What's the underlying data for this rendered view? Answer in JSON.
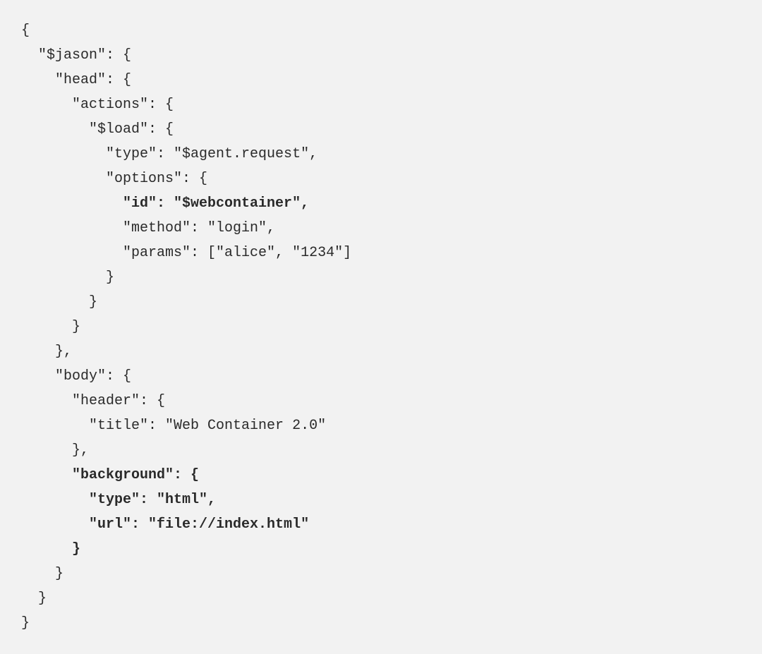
{
  "code": {
    "lines": [
      {
        "text": "{",
        "bold": false
      },
      {
        "text": "  \"$jason\": {",
        "bold": false
      },
      {
        "text": "    \"head\": {",
        "bold": false
      },
      {
        "text": "      \"actions\": {",
        "bold": false
      },
      {
        "text": "        \"$load\": {",
        "bold": false
      },
      {
        "text": "          \"type\": \"$agent.request\",",
        "bold": false
      },
      {
        "text": "          \"options\": {",
        "bold": false
      },
      {
        "text": "            \"id\": \"$webcontainer\",",
        "bold": true
      },
      {
        "text": "            \"method\": \"login\",",
        "bold": false
      },
      {
        "text": "            \"params\": [\"alice\", \"1234\"]",
        "bold": false
      },
      {
        "text": "          }",
        "bold": false
      },
      {
        "text": "        }",
        "bold": false
      },
      {
        "text": "      }",
        "bold": false
      },
      {
        "text": "    },",
        "bold": false
      },
      {
        "text": "    \"body\": {",
        "bold": false
      },
      {
        "text": "      \"header\": {",
        "bold": false
      },
      {
        "text": "        \"title\": \"Web Container 2.0\"",
        "bold": false
      },
      {
        "text": "      },",
        "bold": false
      },
      {
        "text": "      \"background\": {",
        "bold": true
      },
      {
        "text": "        \"type\": \"html\",",
        "bold": true
      },
      {
        "text": "        \"url\": \"file://index.html\"",
        "bold": true
      },
      {
        "text": "      }",
        "bold": true
      },
      {
        "text": "    }",
        "bold": false
      },
      {
        "text": "  }",
        "bold": false
      },
      {
        "text": "}",
        "bold": false
      }
    ]
  }
}
